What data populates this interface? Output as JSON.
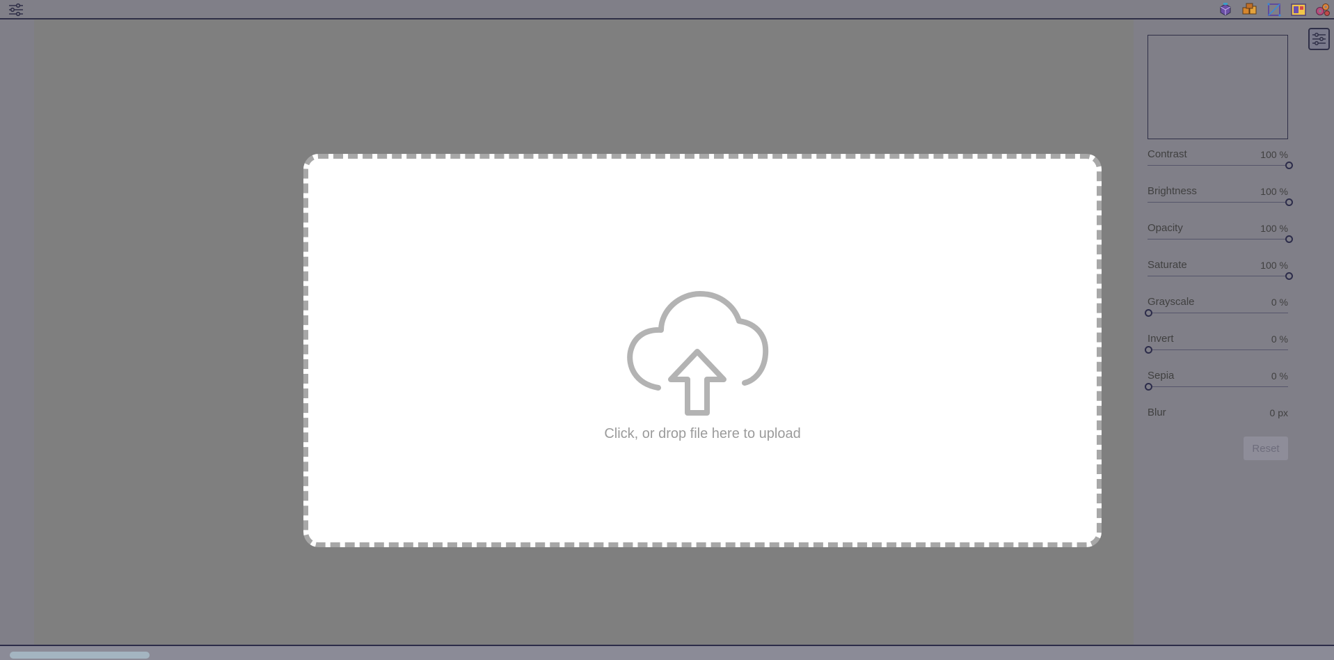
{
  "topbar": {
    "menu_icon": "sliders-icon",
    "app_icons": [
      "cube-icon",
      "boxes-icon",
      "crop-icon",
      "image-frame-icon",
      "gears-icon"
    ]
  },
  "dropzone": {
    "icon": "cloud-upload-icon",
    "text": "Click, or drop file here to upload"
  },
  "panel": {
    "controls": [
      {
        "label": "Contrast",
        "value": "100 %",
        "level": 1.0
      },
      {
        "label": "Brightness",
        "value": "100 %",
        "level": 1.0
      },
      {
        "label": "Opacity",
        "value": "100 %",
        "level": 1.0
      },
      {
        "label": "Saturate",
        "value": "100 %",
        "level": 1.0
      },
      {
        "label": "Grayscale",
        "value": "0 %",
        "level": 0.0
      },
      {
        "label": "Invert",
        "value": "0 %",
        "level": 0.0
      },
      {
        "label": "Sepia",
        "value": "0 %",
        "level": 0.0
      },
      {
        "label": "Blur",
        "value": "0 px"
      }
    ],
    "reset_label": "Reset",
    "toggle_icon": "sliders-icon"
  },
  "colors": {
    "background": "#7f7f7f",
    "chrome": "#807f88",
    "accent": "#2f2f47",
    "dropzone_border": "#a7a7a7",
    "dropzone_text": "#9b9b9b"
  }
}
